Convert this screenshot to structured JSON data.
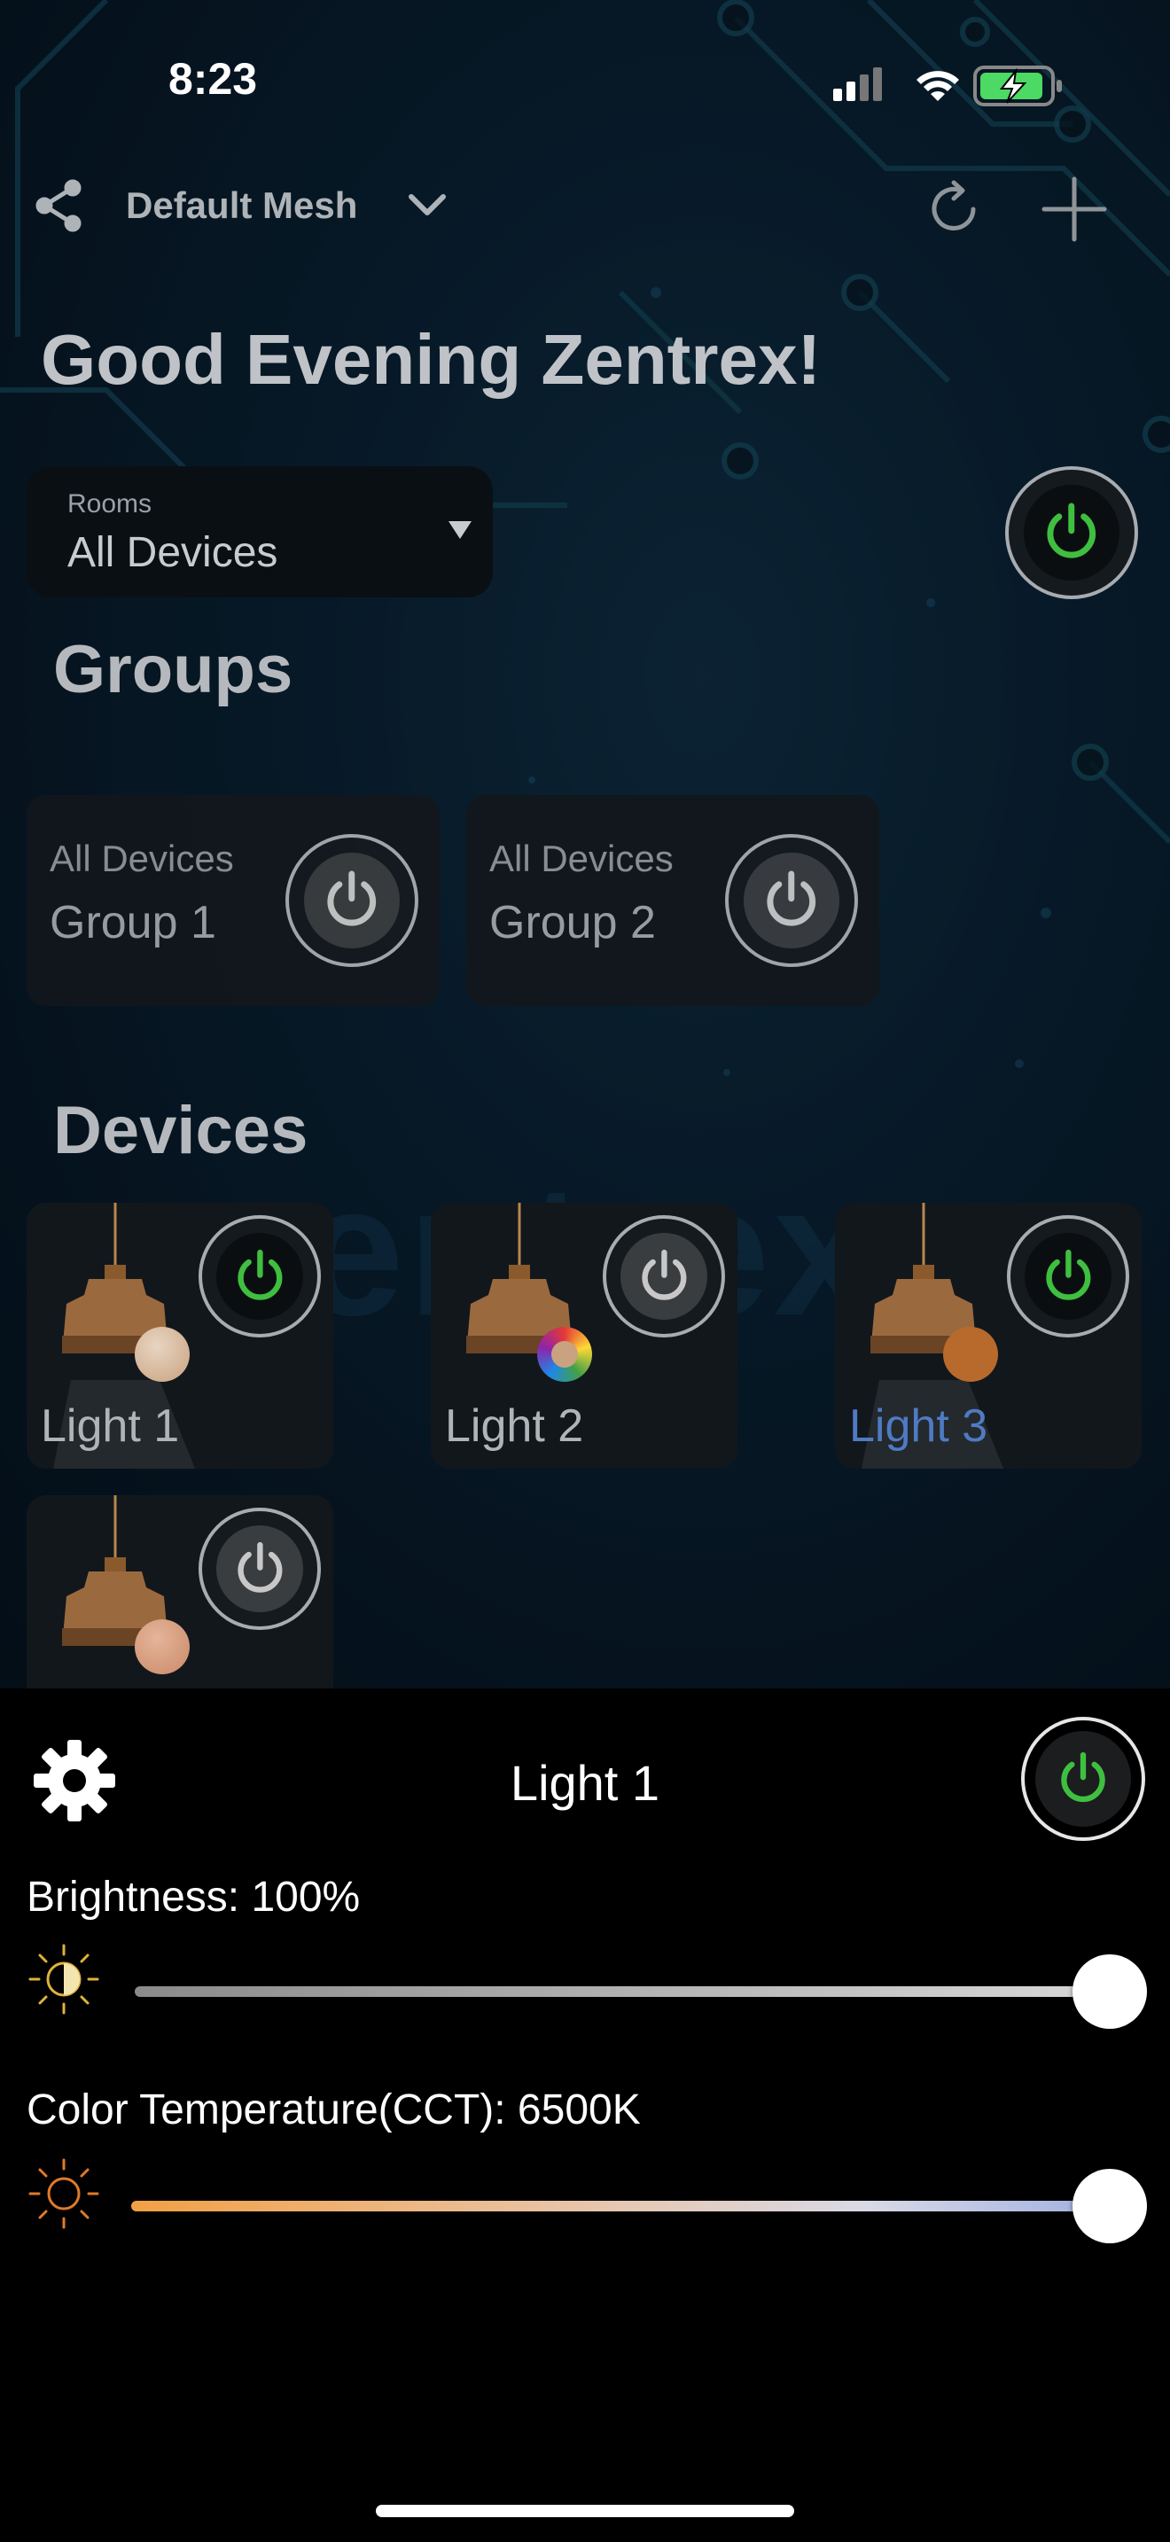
{
  "status_bar": {
    "time": "8:23"
  },
  "header": {
    "mesh_name": "Default Mesh",
    "greeting": "Good Evening Zentrex!"
  },
  "rooms": {
    "label": "Rooms",
    "value": "All Devices"
  },
  "groups": {
    "title": "Groups",
    "items": [
      {
        "sub": "All Devices",
        "name": "Group 1",
        "power": "off"
      },
      {
        "sub": "All Devices",
        "name": "Group 2",
        "power": "off"
      }
    ]
  },
  "devices": {
    "title": "Devices",
    "items": [
      {
        "name": "Light 1",
        "power": "on",
        "swatch": "#c9a27f"
      },
      {
        "name": "Light 2",
        "power": "off",
        "swatch": "rainbow"
      },
      {
        "name": "Light 3",
        "power": "on",
        "swatch": "#b86a2c"
      },
      {
        "name": "",
        "power": "off",
        "swatch": "#c99070"
      }
    ]
  },
  "watermark": "zentrex",
  "sheet": {
    "title": "Light 1",
    "brightness_label": "Brightness: 100%",
    "brightness_value": 100,
    "cct_label": "Color Temperature(CCT): 6500K",
    "cct_value_k": 6500
  },
  "colors": {
    "power_on": "#3fbf3f",
    "power_off": "#c8c8c8",
    "active_device_text": "#4f7bc4",
    "sheet_bg": "#000000"
  }
}
